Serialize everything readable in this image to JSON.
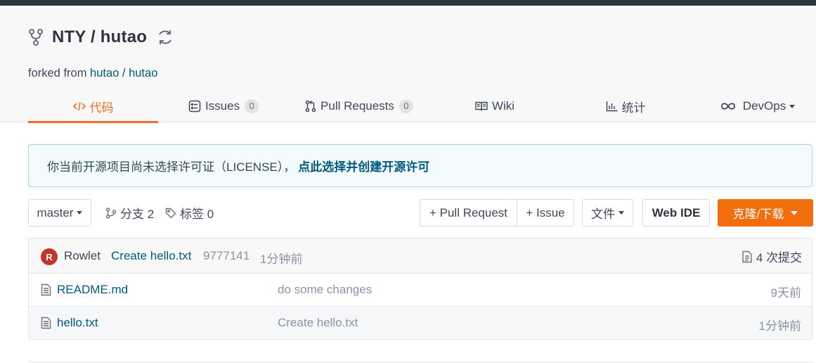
{
  "repo": {
    "owner": "NTY",
    "separator": " / ",
    "name": "hutao",
    "forked_prefix": "forked from ",
    "forked_from": "hutao / hutao"
  },
  "tabs": [
    {
      "label": "代码",
      "icon": "code-icon",
      "active": true
    },
    {
      "label": "Issues",
      "icon": "issues-icon",
      "count": "0"
    },
    {
      "label": "Pull Requests",
      "icon": "pull-request-icon",
      "count": "0"
    },
    {
      "label": "Wiki",
      "icon": "wiki-icon"
    },
    {
      "label": "统计",
      "icon": "stats-icon"
    },
    {
      "label": "DevOps",
      "icon": "infinity-icon",
      "dropdown": true
    }
  ],
  "notice": {
    "text": "你当前开源项目尚未选择许可证（LICENSE），",
    "link": "点此选择并创建开源许可"
  },
  "toolbar": {
    "branch": "master",
    "branches_label": "分支 2",
    "tags_label": "标签 0",
    "pull_request": "+ Pull Request",
    "issue": "+ Issue",
    "files": "文件",
    "web_ide": "Web IDE",
    "clone": "克隆/下载"
  },
  "last_commit": {
    "avatar_letter": "R",
    "author": "Rowlet",
    "message": "Create hello.txt",
    "sha": "9777141",
    "time": "1分钟前",
    "commit_count": "4 次提交"
  },
  "files": [
    {
      "name": "README.md",
      "message": "do some changes",
      "time": "9天前"
    },
    {
      "name": "hello.txt",
      "message": "Create hello.txt",
      "time": "1分钟前"
    }
  ],
  "colors": {
    "accent": "#f26d0c",
    "link": "#005980",
    "topbar": "#2e3440",
    "notice_border": "#a6d6dd",
    "avatar": "#c0392b"
  }
}
